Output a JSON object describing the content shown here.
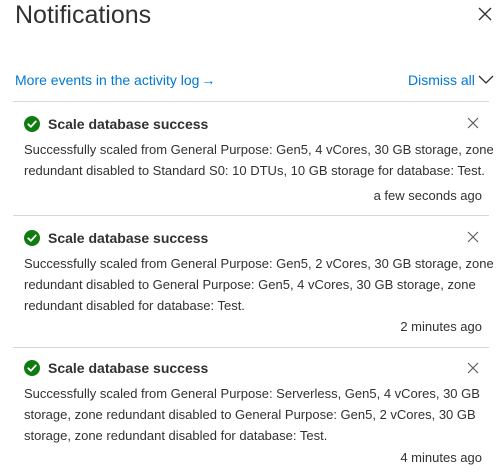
{
  "header": {
    "title": "Notifications",
    "close_icon": "close-icon"
  },
  "toolbar": {
    "activity_link": "More events in the activity log",
    "activity_arrow": "→",
    "dismiss_all": "Dismiss all",
    "expand_icon": "chevron-down-icon"
  },
  "colors": {
    "link": "#0078d4",
    "success": "#107c10",
    "text": "#323130"
  },
  "notifications": [
    {
      "status_icon": "success-check-icon",
      "title": "Scale database success",
      "body_lines": [
        "Successfully scaled from General Purpose: Gen5, 4 vCores, 30 GB storage, zone",
        "redundant disabled to Standard S0: 10 DTUs, 10 GB storage for database: Test."
      ],
      "time": "a few seconds ago"
    },
    {
      "status_icon": "success-check-icon",
      "title": "Scale database success",
      "body_lines": [
        "Successfully scaled from General Purpose: Gen5, 2 vCores, 30 GB storage, zone",
        "redundant disabled to General Purpose: Gen5, 4 vCores, 30 GB storage, zone",
        "redundant disabled for database: Test."
      ],
      "time": "2 minutes ago"
    },
    {
      "status_icon": "success-check-icon",
      "title": "Scale database success",
      "body_lines": [
        "Successfully scaled from General Purpose: Serverless, Gen5, 4 vCores, 30 GB",
        "storage, zone redundant disabled to General Purpose: Gen5, 2 vCores, 30 GB",
        "storage, zone redundant disabled for database: Test."
      ],
      "time": "4 minutes ago"
    }
  ]
}
